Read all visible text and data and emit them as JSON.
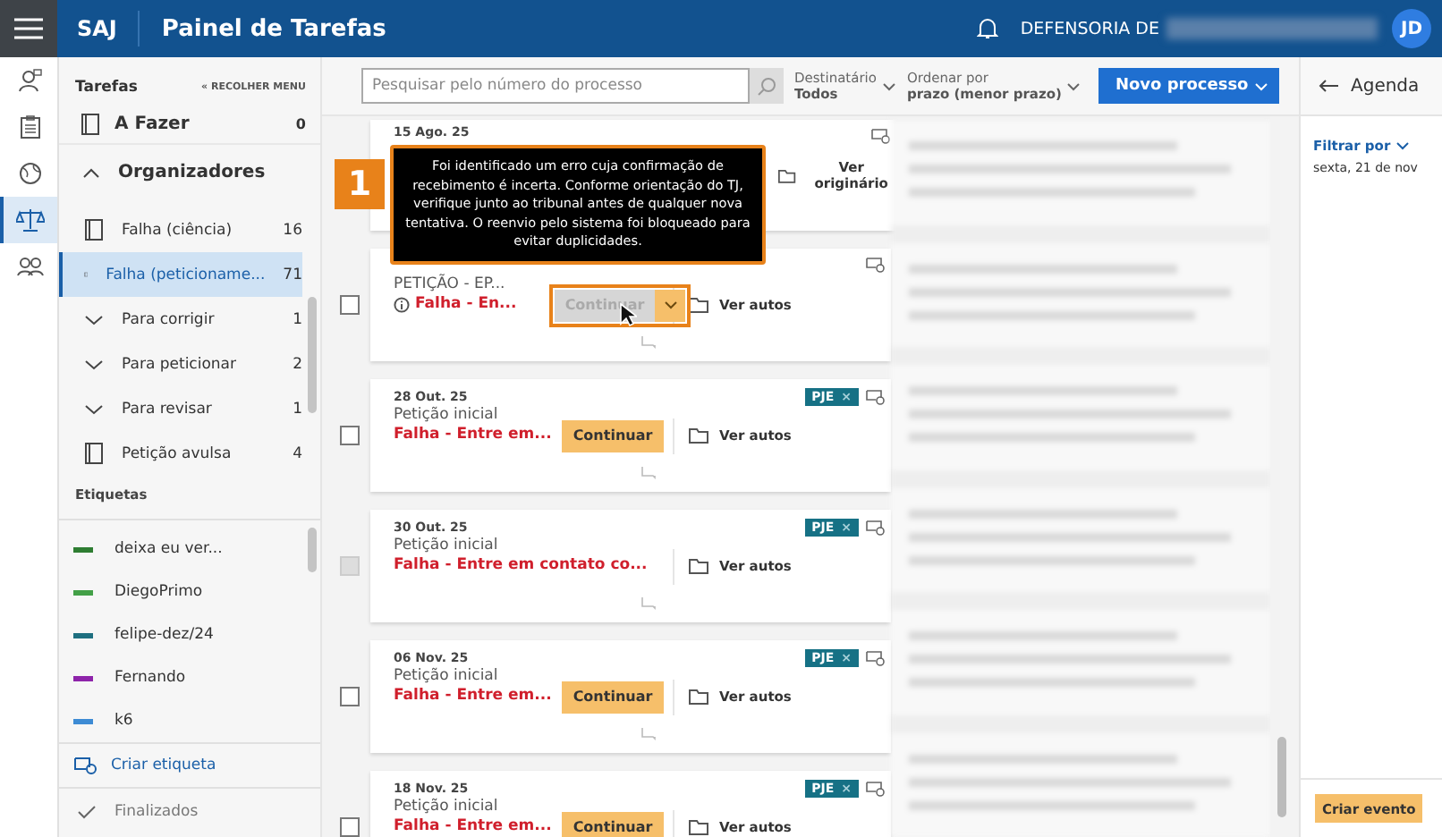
{
  "topbar": {
    "brand": "SAJ",
    "title": "Painel de Tarefas",
    "org": "DEFENSORIA DE",
    "avatar": "JD"
  },
  "rail": [
    {
      "kind": "person",
      "selected": false
    },
    {
      "kind": "clipboard",
      "selected": false
    },
    {
      "kind": "globe",
      "selected": false
    },
    {
      "kind": "scale",
      "selected": true
    },
    {
      "kind": "people",
      "selected": false
    }
  ],
  "sidebar": {
    "title": "Tarefas",
    "collapse": "« RECOLHER MENU",
    "todo": {
      "label": "A Fazer",
      "count": "0"
    },
    "organizers": {
      "label": "Organizadores",
      "expanded": true
    },
    "items": [
      {
        "kind": "book",
        "label": "Falha (ciência)",
        "count": "16",
        "selected": false
      },
      {
        "kind": "book",
        "label": "Falha (peticioname...",
        "count": "71",
        "selected": true
      },
      {
        "kind": "chevron",
        "label": "Para corrigir",
        "count": "1",
        "selected": false
      },
      {
        "kind": "chevron",
        "label": "Para peticionar",
        "count": "2",
        "selected": false
      },
      {
        "kind": "chevron",
        "label": "Para revisar",
        "count": "1",
        "selected": false
      },
      {
        "kind": "book",
        "label": "Petição avulsa",
        "count": "4",
        "selected": false
      }
    ],
    "labels_title": "Etiquetas",
    "labels": [
      {
        "label": "deixa eu ver...",
        "color": "#2e7d32"
      },
      {
        "label": "DiegoPrimo",
        "color": "#43a047"
      },
      {
        "label": "felipe-dez/24",
        "color": "#1e6f80"
      },
      {
        "label": "Fernando",
        "color": "#8e24aa"
      },
      {
        "label": "k6",
        "color": "#3d8bd4"
      }
    ],
    "create_label": "Criar etiqueta",
    "finished": "Finalizados"
  },
  "toolbar": {
    "search_placeholder": "Pesquisar pelo número do processo",
    "recipient_label": "Destinatário",
    "recipient_value": "Todos",
    "sort_label": "Ordenar por",
    "sort_value": "prazo (menor prazo)",
    "new_button": "Novo processo"
  },
  "cards": [
    {
      "date": "15 Ago. 25",
      "link": "Ver originário"
    },
    {
      "title": "PETIÇÃO - EP...",
      "status": "Falha - En...",
      "status_icon": true,
      "continue_label": "Continuar",
      "continue_disabled": true,
      "link": "Ver autos",
      "checkbox_disabled": false,
      "highlighted": true
    },
    {
      "date": "28 Out. 25",
      "title": "Petição inicial",
      "status": "Falha - Entre em...",
      "status_icon": false,
      "continue_label": "Continuar",
      "continue_disabled": false,
      "link": "Ver autos",
      "tag": {
        "label": "PJE",
        "remove": "×"
      },
      "checkbox_disabled": false
    },
    {
      "date": "30 Out. 25",
      "title": "Petição inicial",
      "status": "Falha - Entre em contato co...",
      "status_icon": false,
      "link": "Ver autos",
      "tag": {
        "label": "PJE",
        "remove": "×"
      },
      "checkbox_disabled": true
    },
    {
      "date": "06 Nov. 25",
      "title": "Petição inicial",
      "status": "Falha - Entre em...",
      "status_icon": false,
      "continue_label": "Continuar",
      "continue_disabled": false,
      "link": "Ver autos",
      "tag": {
        "label": "PJE",
        "remove": "×"
      },
      "checkbox_disabled": false
    },
    {
      "date": "18 Nov. 25",
      "title": "Petição inicial",
      "status": "Falha - Entre em...",
      "status_icon": false,
      "continue_label": "Continuar",
      "continue_disabled": false,
      "link": "Ver autos",
      "tag": {
        "label": "PJE",
        "remove": "×"
      },
      "checkbox_disabled": false
    }
  ],
  "callout": {
    "number": "1",
    "text": "Foi identificado um erro cuja confirmação de recebimento é incerta. Conforme orientação do TJ, verifique junto ao tribunal antes de qualquer nova tentativa. O reenvio pelo sistema foi bloqueado para evitar duplicidades."
  },
  "agenda": {
    "title": "Agenda",
    "filter": "Filtrar por",
    "date": "sexta, 21 de nov",
    "create": "Criar evento"
  }
}
